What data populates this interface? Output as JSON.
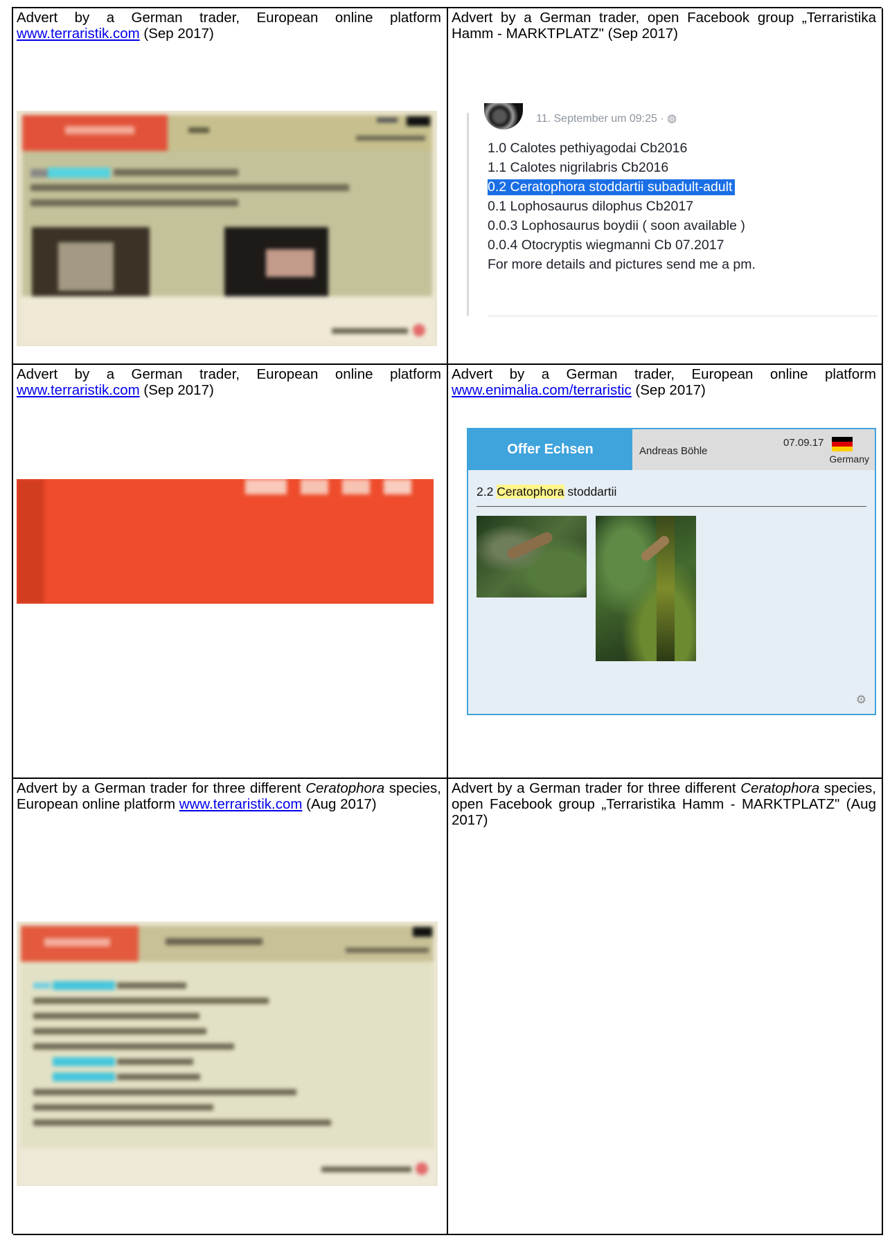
{
  "cells": [
    {
      "id": "r1c1",
      "caption_pre": "Advert by a German trader, European online platform ",
      "link": "www.terraristik.com",
      "caption_post": " (Sep 2017)"
    },
    {
      "id": "r1c2",
      "caption_pre": "Advert by a German trader, open Facebook group „Terraristika Hamm - MARKTPLATZ\" (Sep 2017)"
    },
    {
      "id": "r2c1",
      "caption_pre": "Advert by a German trader, European online platform ",
      "link": "www.terraristik.com",
      "caption_post": " (Sep 2017)"
    },
    {
      "id": "r2c2",
      "caption_pre": "Advert by a German trader, European online platform ",
      "link": "www.enimalia.com/terraristic",
      "caption_post": " (Sep 2017)"
    },
    {
      "id": "r3c1",
      "caption_pre": "Advert by a German trader for three different ",
      "caption_italic": "Ceratophora",
      "caption_mid": " species, European online platform ",
      "link": "www.terraristik.com",
      "caption_post": " (Aug 2017)"
    },
    {
      "id": "r3c2",
      "caption_pre": "Advert by a German trader for three different ",
      "caption_italic": "Ceratophora",
      "caption_mid": " species, open Facebook group „Terraristika Hamm - MARKTPLATZ\" (Aug 2017)"
    }
  ],
  "facebook_post": {
    "timestamp": "11. September um 09:25 · ◍",
    "lines": [
      "1.0 Calotes pethiyagodai Cb2016",
      "1.1 Calotes nigrilabris Cb2016",
      "0.2 Ceratophora stoddartii subadult-adult",
      "0.1 Lophosaurus dilophus Cb2017",
      "0.0.3 Lophosaurus boydii ( soon available )",
      "0.0.4 Otocryptis wiegmanni Cb 07.2017",
      "For more details and pictures send me a pm."
    ],
    "highlighted_line": 2
  },
  "enimalia_ad": {
    "tab": "Offer Echsen",
    "author": "Andreas Böhle",
    "date": "07.09.17",
    "country": "Germany",
    "title_count": "2.2 ",
    "title_genus": "Ceratophora",
    "title_species": " stoddartii",
    "settings_icon": "gear-icon",
    "flag_colors": [
      "#000000",
      "#dd0000",
      "#ffce00"
    ],
    "tab_color": "#3fa3dc"
  }
}
